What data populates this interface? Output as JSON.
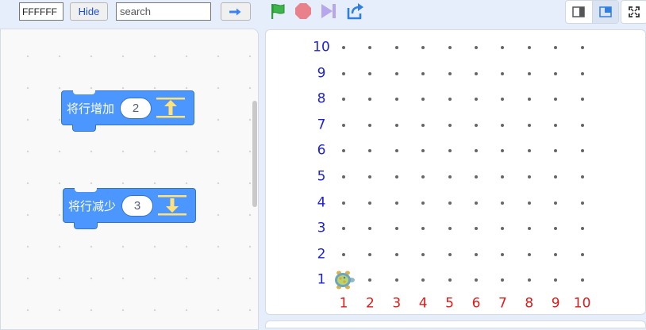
{
  "toolbar": {
    "color_value": "FFFFFF",
    "hide_label": "Hide",
    "search_placeholder": "search",
    "icons": {
      "go": "arrow-right-icon",
      "start": "green-flag-icon",
      "stop": "stop-icon",
      "step": "step-forward-icon",
      "share": "share-export-icon",
      "small_stage": "small-stage-icon",
      "large_stage": "large-stage-icon",
      "fullscreen": "fullscreen-icon"
    }
  },
  "workspace": {
    "blocks": [
      {
        "label": "将行增加",
        "value": "2",
        "icon": "row-increase-icon"
      },
      {
        "label": "将行减少",
        "value": "3",
        "icon": "row-decrease-icon"
      }
    ]
  },
  "stage": {
    "grid": {
      "y_labels": [
        "10",
        "9",
        "8",
        "7",
        "6",
        "5",
        "4",
        "3",
        "2",
        "1"
      ],
      "x_labels": [
        "1",
        "2",
        "3",
        "4",
        "5",
        "6",
        "7",
        "8",
        "9",
        "10"
      ],
      "y_label_color": "#1e22d6",
      "x_label_color": "#e01a1a",
      "dot_color": "#666666"
    },
    "sprite": {
      "name": "turtle-sprite",
      "column": 1,
      "row": 1
    }
  },
  "colors": {
    "block_blue": "#4c97ff",
    "accent_yellow": "#ffe27a",
    "flag_green": "#2f9e3a",
    "stop_red": "#e9818c"
  }
}
